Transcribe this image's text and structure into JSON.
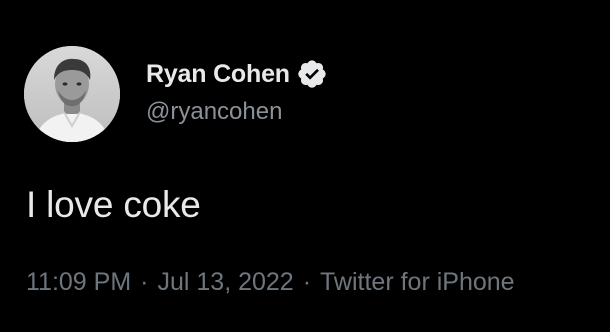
{
  "author": {
    "display_name": "Ryan Cohen",
    "handle": "@ryancohen",
    "verified": true,
    "avatar_icon": "profile-photo"
  },
  "tweet": {
    "text": "I love coke",
    "time": "11:09 PM",
    "date": "Jul 13, 2022",
    "source": "Twitter for iPhone",
    "separator": "·"
  },
  "colors": {
    "background": "#000000",
    "text_primary": "#e7e9ea",
    "text_secondary": "#6e767d",
    "handle": "#8b9196",
    "verified_badge": "#e7e9ea"
  }
}
